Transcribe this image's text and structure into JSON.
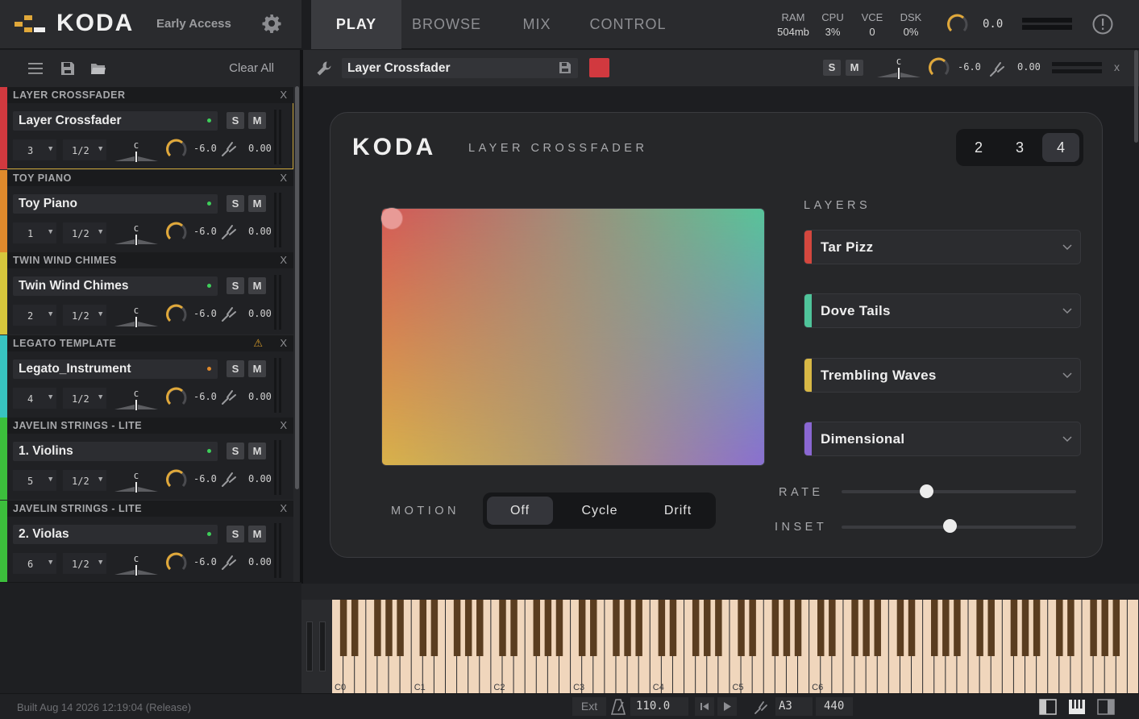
{
  "app": {
    "logo": "KODA",
    "badge": "Early Access",
    "tabs": [
      {
        "label": "PLAY",
        "active": true
      },
      {
        "label": "BROWSE",
        "active": false
      },
      {
        "label": "MIX",
        "active": false
      },
      {
        "label": "CONTROL",
        "active": false
      }
    ],
    "stats": [
      {
        "label": "RAM",
        "value": "504mb"
      },
      {
        "label": "CPU",
        "value": "3%"
      },
      {
        "label": "VCE",
        "value": "0"
      },
      {
        "label": "DSK",
        "value": "0%"
      }
    ],
    "master_volume": "0.0"
  },
  "rack": {
    "clear_all": "Clear All",
    "instruments": [
      {
        "header": "LAYER CROSSFADER",
        "name": "Layer Crossfader",
        "channel": "3",
        "division": "1/2",
        "pan": "C",
        "volume": "-6.0",
        "tune": "0.00",
        "color": "#d1393f",
        "led": "#3ecf5a",
        "warning": false,
        "selected": true
      },
      {
        "header": "TOY PIANO",
        "name": "Toy Piano",
        "channel": "1",
        "division": "1/2",
        "pan": "C",
        "volume": "-6.0",
        "tune": "0.00",
        "color": "#e08a2c",
        "led": "#3ecf5a",
        "warning": false,
        "selected": false
      },
      {
        "header": "TWIN WIND CHIMES",
        "name": "Twin Wind Chimes",
        "channel": "2",
        "division": "1/2",
        "pan": "C",
        "volume": "-6.0",
        "tune": "0.00",
        "color": "#d6c63c",
        "led": "#3ecf5a",
        "warning": false,
        "selected": false
      },
      {
        "header": "LEGATO TEMPLATE",
        "name": "Legato_Instrument",
        "channel": "4",
        "division": "1/2",
        "pan": "C",
        "volume": "-6.0",
        "tune": "0.00",
        "color": "#38c3c0",
        "led": "#e0892a",
        "warning": true,
        "selected": false
      },
      {
        "header": "JAVELIN STRINGS - LITE",
        "name": "1. Violins",
        "channel": "5",
        "division": "1/2",
        "pan": "C",
        "volume": "-6.0",
        "tune": "0.00",
        "color": "#3cbf3c",
        "led": "#3ecf5a",
        "warning": false,
        "selected": false
      },
      {
        "header": "JAVELIN STRINGS - LITE",
        "name": "2. Violas",
        "channel": "6",
        "division": "1/2",
        "pan": "C",
        "volume": "-6.0",
        "tune": "0.00",
        "color": "#3cbf3c",
        "led": "#3ecf5a",
        "warning": false,
        "selected": false
      }
    ],
    "solo_label": "S",
    "mute_label": "M",
    "close_label": "X"
  },
  "instrument_header": {
    "name": "Layer Crossfader",
    "color": "#d1393f",
    "pan": "C",
    "volume": "-6.0",
    "tune": "0.00",
    "close_label": "x"
  },
  "panel": {
    "logo": "KODA",
    "title": "LAYER CROSSFADER",
    "layer_counts": [
      {
        "label": "2",
        "active": false
      },
      {
        "label": "3",
        "active": false
      },
      {
        "label": "4",
        "active": true
      }
    ],
    "layers_label": "LAYERS",
    "layers": [
      {
        "name": "Tar Pizz",
        "color": "#d4473e"
      },
      {
        "name": "Dove Tails",
        "color": "#4fc49a"
      },
      {
        "name": "Trembling Waves",
        "color": "#d8b845"
      },
      {
        "name": "Dimensional",
        "color": "#8a67d2"
      }
    ],
    "xy_position": {
      "x": 0.0,
      "y": 1.0
    },
    "motion_label": "MOTION",
    "motion_options": [
      {
        "label": "Off",
        "active": true
      },
      {
        "label": "Cycle",
        "active": false
      },
      {
        "label": "Drift",
        "active": false
      }
    ],
    "rate_label": "RATE",
    "rate_value": 0.36,
    "inset_label": "INSET",
    "inset_value": 0.46
  },
  "keyboard": {
    "octave_labels": [
      "C0",
      "C1",
      "C2",
      "C3",
      "C4",
      "C5",
      "C6"
    ]
  },
  "status": {
    "build": "Built Aug 14 2026 12:19:04 (Release)",
    "sync": "Ext",
    "tempo": "110.0",
    "note": "A3",
    "frequency": "440"
  }
}
